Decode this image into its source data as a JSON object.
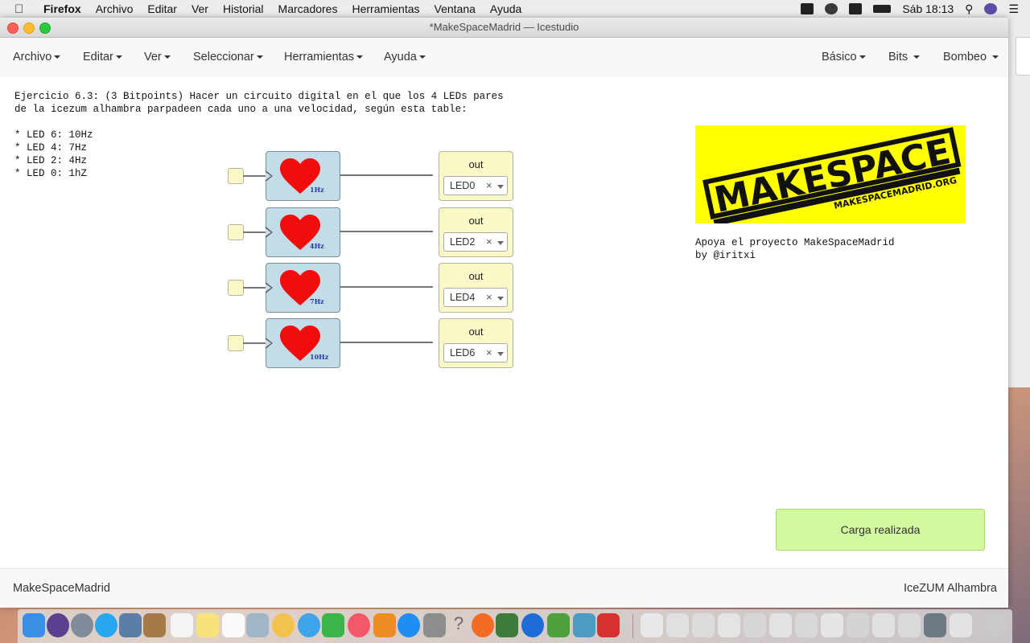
{
  "menubar": {
    "app": "Firefox",
    "items": [
      "Archivo",
      "Editar",
      "Ver",
      "Historial",
      "Marcadores",
      "Herramientas",
      "Ventana",
      "Ayuda"
    ],
    "clock": "Sáb 18:13"
  },
  "window": {
    "title": "*MakeSpaceMadrid — Icestudio"
  },
  "appmenu": {
    "left": [
      "Archivo",
      "Editar",
      "Ver",
      "Seleccionar",
      "Herramientas",
      "Ayuda"
    ],
    "right": [
      "Básico",
      "Bits",
      "Bombeo"
    ]
  },
  "canvas": {
    "description": "Ejercicio 6.3: (3 Bitpoints) Hacer un circuito digital en el que los 4 LEDs pares\nde la icezum alhambra parpadeen cada uno a una velocidad, según esta table:",
    "list": "* LED 6: 10Hz\n* LED 4: 7Hz\n* LED 2: 4Hz\n* LED 0: 1hZ",
    "rows": [
      {
        "freq": "1Hz",
        "out_label": "out",
        "led": "LED0"
      },
      {
        "freq": "4Hz",
        "out_label": "out",
        "led": "LED2"
      },
      {
        "freq": "7Hz",
        "out_label": "out",
        "led": "LED4"
      },
      {
        "freq": "10Hz",
        "out_label": "out",
        "led": "LED6"
      }
    ],
    "select_clear": "×",
    "logo": {
      "main": "MAKESPACE",
      "url": "MAKESPACEMADRID.ORG",
      "bg": "#ffff00"
    },
    "support": "Apoya el proyecto MakeSpaceMadrid\nby @iritxi",
    "toast": "Carga realizada"
  },
  "footer": {
    "left": "MakeSpaceMadrid",
    "right": "IceZUM Alhambra"
  }
}
